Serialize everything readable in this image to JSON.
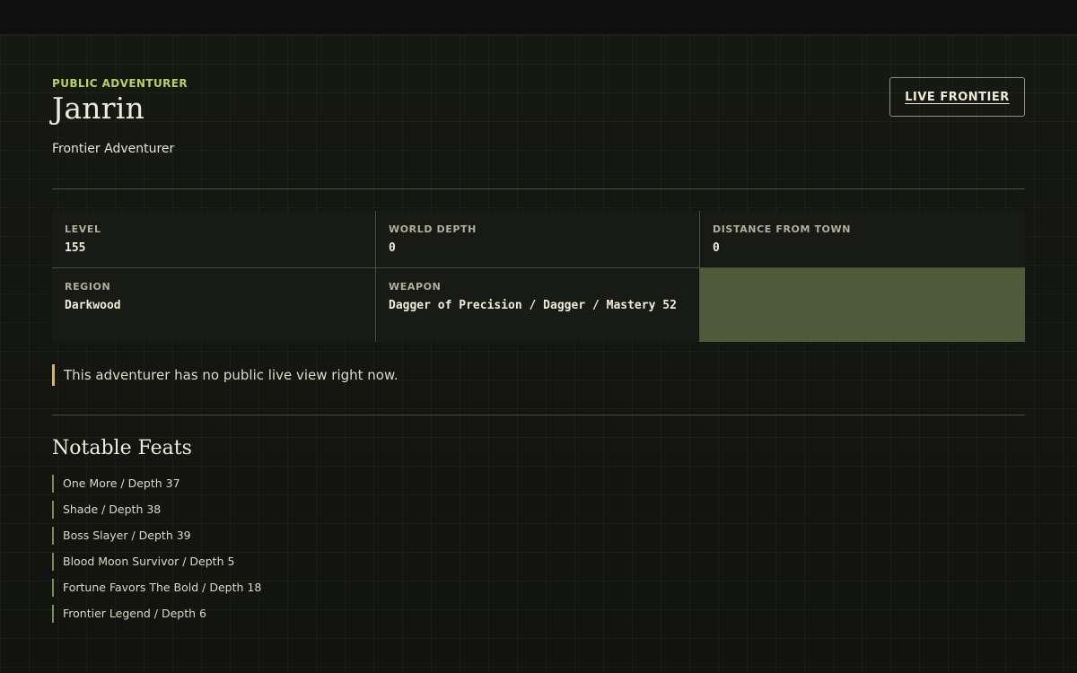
{
  "profile": {
    "eyebrow": "PUBLIC ADVENTURER",
    "name": "Janrin",
    "subtitle": "Frontier Adventurer"
  },
  "header": {
    "live_button": "LIVE FRONTIER"
  },
  "stats": [
    {
      "label": "LEVEL",
      "value": "155"
    },
    {
      "label": "WORLD DEPTH",
      "value": "0"
    },
    {
      "label": "DISTANCE FROM TOWN",
      "value": "0"
    },
    {
      "label": "REGION",
      "value": "Darkwood"
    },
    {
      "label": "WEAPON",
      "value": "Dagger of Precision / Dagger / Mastery 52"
    }
  ],
  "notice": "This adventurer has no public live view right now.",
  "feats": {
    "title": "Notable Feats",
    "items": [
      "One More / Depth 37",
      "Shade / Depth 38",
      "Boss Slayer / Depth 39",
      "Blood Moon Survivor / Depth 5",
      "Fortune Favors The Bold / Depth 18",
      "Frontier Legend / Depth 6"
    ]
  },
  "colors": {
    "accent_green": "#b9cf6b",
    "notice_bar": "#d8b271",
    "filler_cell": "#4f5a3a",
    "feat_bar": "#7d8a53"
  }
}
